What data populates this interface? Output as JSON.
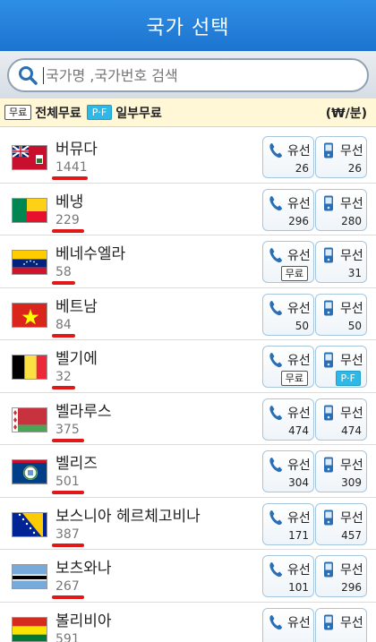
{
  "header": {
    "title": "국가 선택"
  },
  "search": {
    "placeholder": "국가명 ,국가번호 검색"
  },
  "legend": {
    "free_badge": "무료",
    "all_free": "전체무료",
    "pf_badge": "P·F",
    "partial_free": "일부무료",
    "unit": "(₩/분)"
  },
  "labels": {
    "wired": "유선",
    "mobile": "무선"
  },
  "countries": [
    {
      "name": "버뮤다",
      "code": "1441",
      "wired": "26",
      "mobile": "26",
      "flag": "bermuda-flag"
    },
    {
      "name": "베냉",
      "code": "229",
      "wired": "296",
      "mobile": "280",
      "flag": "benin-flag"
    },
    {
      "name": "베네수엘라",
      "code": "58",
      "wired": "무료",
      "mobile": "31",
      "flag": "venezuela-flag"
    },
    {
      "name": "베트남",
      "code": "84",
      "wired": "50",
      "mobile": "50",
      "flag": "vietnam-flag"
    },
    {
      "name": "벨기에",
      "code": "32",
      "wired": "무료",
      "mobile": "P·F",
      "flag": "belgium-flag"
    },
    {
      "name": "벨라루스",
      "code": "375",
      "wired": "474",
      "mobile": "474",
      "flag": "belarus-flag"
    },
    {
      "name": "벨리즈",
      "code": "501",
      "wired": "304",
      "mobile": "309",
      "flag": "belize-flag"
    },
    {
      "name": "보스니아 헤르체고비나",
      "code": "387",
      "wired": "171",
      "mobile": "457",
      "flag": "bosnia-flag"
    },
    {
      "name": "보츠와나",
      "code": "267",
      "wired": "101",
      "mobile": "296",
      "flag": "botswana-flag"
    },
    {
      "name": "볼리비아",
      "code": "591",
      "wired": "",
      "mobile": "",
      "flag": "bolivia-flag"
    }
  ],
  "colors": {
    "header": "#1c74cf",
    "underline": "#e01818",
    "pf": "#2fb8e6"
  }
}
